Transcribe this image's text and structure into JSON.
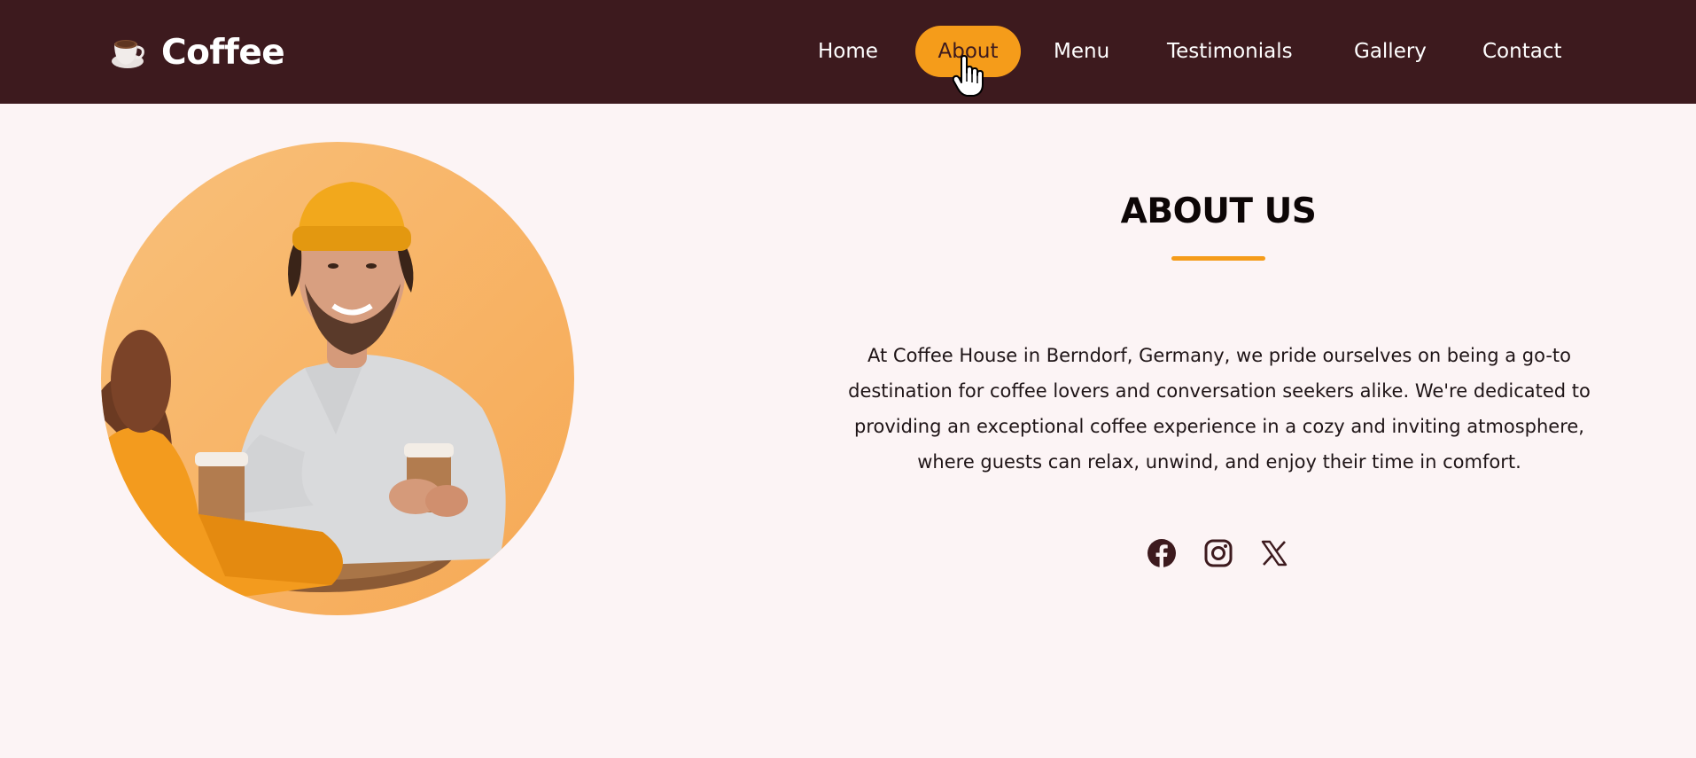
{
  "header": {
    "brand": "Coffee",
    "nav": [
      {
        "label": "Home"
      },
      {
        "label": "About"
      },
      {
        "label": "Menu"
      },
      {
        "label": "Testimonials"
      },
      {
        "label": "Gallery"
      },
      {
        "label": "Contact"
      }
    ],
    "active_nav": "About"
  },
  "about": {
    "title": "ABOUT US",
    "paragraph": "At Coffee House in Berndorf, Germany, we pride ourselves on being a go-to destination for coffee lovers and conversation seekers alike. We're dedicated to providing an exceptional coffee experience in a cozy and inviting atmosphere, where guests can relax, unwind, and enjoy their time in comfort.",
    "social_icons": [
      "facebook-icon",
      "instagram-icon",
      "x-icon"
    ]
  },
  "colors": {
    "header_bg": "#3d1a1e",
    "accent": "#f59c1a",
    "page_bg": "#fcf4f5",
    "text": "#1e1416"
  }
}
